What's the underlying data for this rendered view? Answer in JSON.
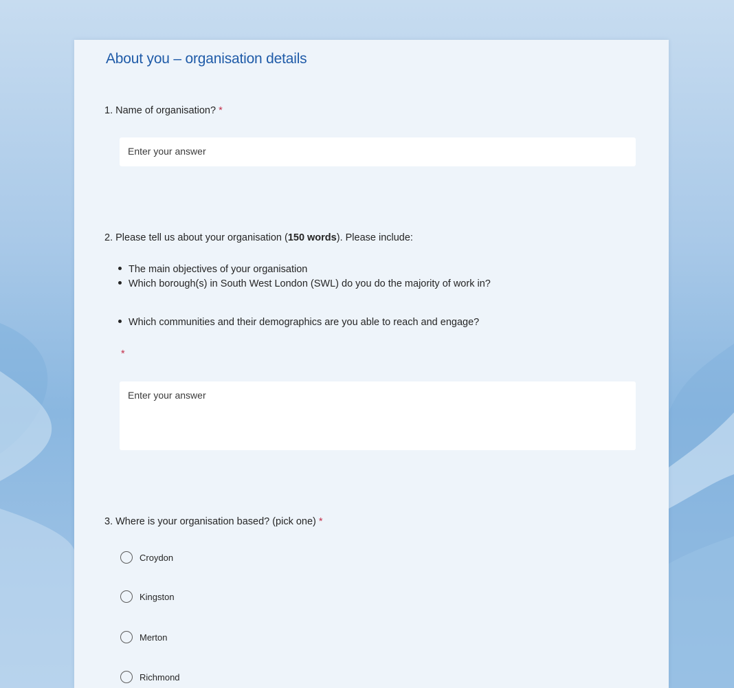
{
  "section": {
    "title": "About you – organisation details"
  },
  "q1": {
    "number": "1.",
    "text": "Name of organisation?",
    "required_mark": "*",
    "placeholder": "Enter your answer"
  },
  "q2": {
    "number": "2.",
    "text_before": "Please tell us about your organisation (",
    "text_bold": "150 words",
    "text_after": ").  Please include:",
    "bullets": [
      "The main objectives of your organisation",
      "Which borough(s) in South West London (SWL) do you do the majority of work in?",
      "Which communities and their demographics are you able to reach and engage?"
    ],
    "required_mark": "*",
    "placeholder": "Enter your answer"
  },
  "q3": {
    "number": "3.",
    "text": "Where is your organisation based? (pick one)",
    "required_mark": "*",
    "options": [
      "Croydon",
      "Kingston",
      "Merton",
      "Richmond"
    ]
  },
  "colors": {
    "title": "#1f5ba8",
    "required": "#c4314b",
    "card_bg": "#eef4fa",
    "page_bg": "#a9c9e8"
  }
}
